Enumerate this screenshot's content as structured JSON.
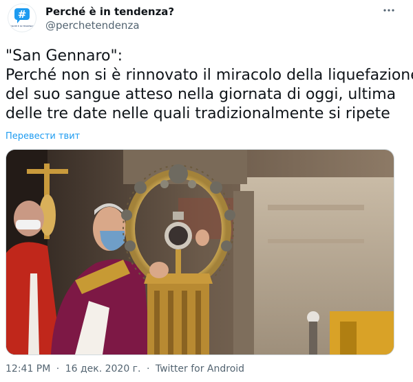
{
  "author": {
    "display_name": "Perché è in tendenza?",
    "handle": "@perchetendenza",
    "avatar_symbol": "#",
    "avatar_caption": "PERCHÈ È IN TENDENZA?"
  },
  "menu_icon": "ellipsis-icon",
  "tweet": {
    "lines": [
      "\"San Gennaro\":",
      "Perché non si è rinnovato il miracolo della liquefazione",
      "del suo sangue atteso nella giornata di oggi, ultima",
      "delle tre date nelle quali tradizionalmente si ripete"
    ],
    "translate_link": "Перевести твит"
  },
  "meta": {
    "time": "12:41 PM",
    "separator": "·",
    "date": "16 дек. 2020 г.",
    "source": "Twitter for Android"
  },
  "colors": {
    "accent": "#1d9bf0",
    "secondary_text": "#536471"
  }
}
